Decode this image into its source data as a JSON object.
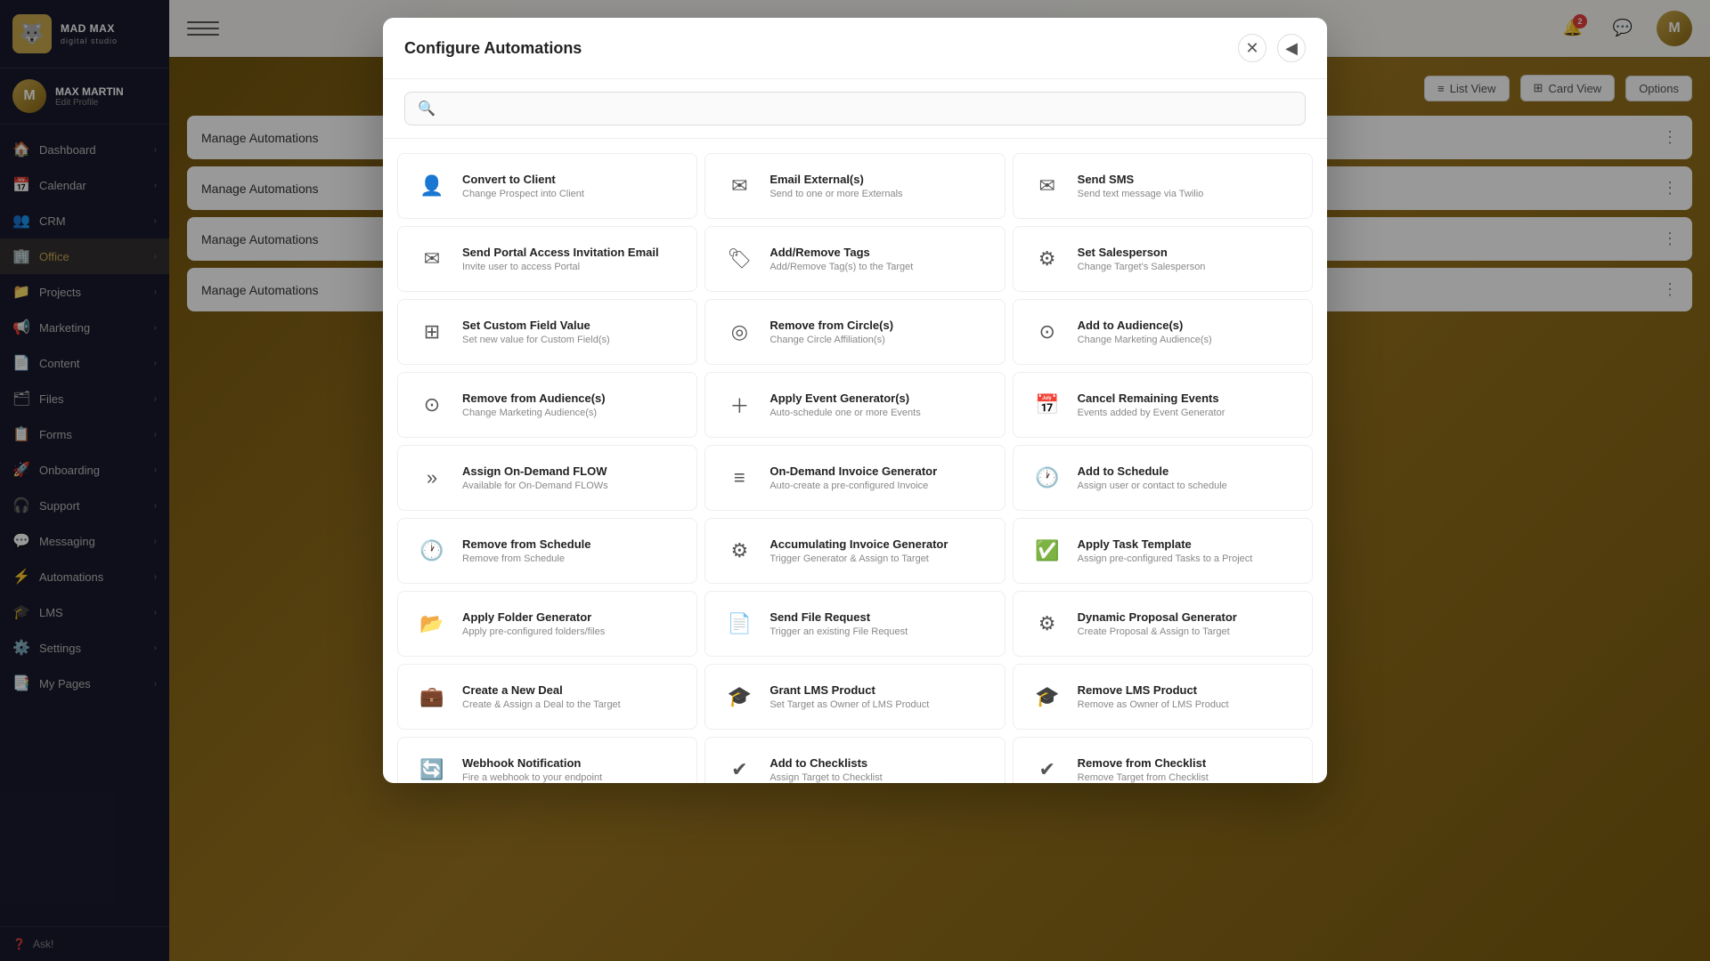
{
  "app": {
    "name": "MAD MAX",
    "sub": "digital studio",
    "logo_emoji": "🐺"
  },
  "user": {
    "name": "MAX MARTIN",
    "edit_label": "Edit Profile",
    "avatar_initials": "M"
  },
  "sidebar": {
    "items": [
      {
        "id": "dashboard",
        "label": "Dashboard",
        "icon": "🏠",
        "has_chevron": true
      },
      {
        "id": "calendar",
        "label": "Calendar",
        "icon": "📅",
        "has_chevron": true
      },
      {
        "id": "crm",
        "label": "CRM",
        "icon": "👥",
        "has_chevron": true
      },
      {
        "id": "office",
        "label": "Office",
        "icon": "🏢",
        "has_chevron": true,
        "active": true
      },
      {
        "id": "projects",
        "label": "Projects",
        "icon": "📁",
        "has_chevron": true
      },
      {
        "id": "marketing",
        "label": "Marketing",
        "icon": "📢",
        "has_chevron": true
      },
      {
        "id": "content",
        "label": "Content",
        "icon": "📄",
        "has_chevron": true
      },
      {
        "id": "files",
        "label": "Files",
        "icon": "🗂",
        "has_chevron": true
      },
      {
        "id": "forms",
        "label": "Forms",
        "icon": "📋",
        "has_chevron": true
      },
      {
        "id": "onboarding",
        "label": "Onboarding",
        "icon": "🚀",
        "has_chevron": true
      },
      {
        "id": "support",
        "label": "Support",
        "icon": "🎧",
        "has_chevron": true
      },
      {
        "id": "messaging",
        "label": "Messaging",
        "icon": "💬",
        "has_chevron": true
      },
      {
        "id": "automations",
        "label": "Automations",
        "icon": "⚡",
        "has_chevron": true
      },
      {
        "id": "lms",
        "label": "LMS",
        "icon": "🎓",
        "has_chevron": true
      },
      {
        "id": "settings",
        "label": "Settings",
        "icon": "⚙️",
        "has_chevron": true
      },
      {
        "id": "mypages",
        "label": "My Pages",
        "icon": "📑",
        "has_chevron": true
      }
    ],
    "bottom": {
      "label": "Ask!",
      "icon": "❓"
    }
  },
  "topbar": {
    "notification_count": "2",
    "view_list_label": "List View",
    "view_card_label": "Card View",
    "options_label": "Options"
  },
  "content": {
    "rows": [
      {
        "label": "Manage Automations"
      },
      {
        "label": "Manage Automations"
      },
      {
        "label": "Manage Automations"
      },
      {
        "label": "Manage Automations"
      }
    ]
  },
  "modal": {
    "title": "Configure Automations",
    "search_placeholder": "",
    "back_icon": "◀",
    "close_icon": "✕",
    "grid_items": [
      {
        "id": "convert-to-client",
        "title": "Convert to Client",
        "desc": "Change Prospect into Client",
        "icon": "👤"
      },
      {
        "id": "email-externals",
        "title": "Email External(s)",
        "desc": "Send to one or more Externals",
        "icon": "@"
      },
      {
        "id": "send-sms",
        "title": "Send SMS",
        "desc": "Send text message via Twilio",
        "icon": "@"
      },
      {
        "id": "send-portal-access",
        "title": "Send Portal Access Invitation Email",
        "desc": "Invite user to access Portal",
        "icon": "✉"
      },
      {
        "id": "add-remove-tags",
        "title": "Add/Remove Tags",
        "desc": "Add/Remove Tag(s) to the Target",
        "icon": "🏷"
      },
      {
        "id": "set-salesperson",
        "title": "Set Salesperson",
        "desc": "Change Target's Salesperson",
        "icon": "⚙"
      },
      {
        "id": "set-custom-field",
        "title": "Set Custom Field Value",
        "desc": "Set new value for Custom Field(s)",
        "icon": "⊞"
      },
      {
        "id": "remove-from-circle",
        "title": "Remove from Circle(s)",
        "desc": "Change Circle Affiliation(s)",
        "icon": "◎"
      },
      {
        "id": "add-to-audiences",
        "title": "Add to Audience(s)",
        "desc": "Change Marketing Audience(s)",
        "icon": "🎯"
      },
      {
        "id": "remove-from-audiences",
        "title": "Remove from Audience(s)",
        "desc": "Change Marketing Audience(s)",
        "icon": "🎯"
      },
      {
        "id": "apply-event-generator",
        "title": "Apply Event Generator(s)",
        "desc": "Auto-schedule one or more Events",
        "icon": "📅"
      },
      {
        "id": "cancel-remaining-events",
        "title": "Cancel Remaining Events",
        "desc": "Events added by Event Generator",
        "icon": "📅"
      },
      {
        "id": "assign-on-demand-flow",
        "title": "Assign On-Demand FLOW",
        "desc": "Available for On-Demand FLOWs",
        "icon": "»"
      },
      {
        "id": "on-demand-invoice-generator",
        "title": "On-Demand Invoice Generator",
        "desc": "Auto-create a pre-configured Invoice",
        "icon": "🧾"
      },
      {
        "id": "add-to-schedule",
        "title": "Add to Schedule",
        "desc": "Assign user or contact to schedule",
        "icon": "🕐"
      },
      {
        "id": "remove-from-schedule",
        "title": "Remove from Schedule",
        "desc": "Remove from Schedule",
        "icon": "🕐"
      },
      {
        "id": "accumulating-invoice-generator",
        "title": "Accumulating Invoice Generator",
        "desc": "Trigger Generator & Assign to Target",
        "icon": "⚙"
      },
      {
        "id": "apply-task-template",
        "title": "Apply Task Template",
        "desc": "Assign pre-configured Tasks to a Project",
        "icon": "✅"
      },
      {
        "id": "apply-folder-generator",
        "title": "Apply Folder Generator",
        "desc": "Apply pre-configured folders/files",
        "icon": "📂"
      },
      {
        "id": "send-file-request",
        "title": "Send File Request",
        "desc": "Trigger an existing File Request",
        "icon": "📄"
      },
      {
        "id": "dynamic-proposal-generator",
        "title": "Dynamic Proposal Generator",
        "desc": "Create Proposal & Assign to Target",
        "icon": "⚙"
      },
      {
        "id": "create-new-deal",
        "title": "Create a New Deal",
        "desc": "Create & Assign a Deal to the Target",
        "icon": "💼"
      },
      {
        "id": "grant-lms-product",
        "title": "Grant LMS Product",
        "desc": "Set Target as Owner of LMS Product",
        "icon": "🎓"
      },
      {
        "id": "remove-lms-product",
        "title": "Remove LMS Product",
        "desc": "Remove as Owner of LMS Product",
        "icon": "🎓"
      },
      {
        "id": "webhook-notification",
        "title": "Webhook Notification",
        "desc": "Fire a webhook to your endpoint",
        "icon": "🔄"
      },
      {
        "id": "add-to-checklists",
        "title": "Add to Checklists",
        "desc": "Assign Target to Checklist",
        "icon": "✔"
      },
      {
        "id": "remove-from-checklist",
        "title": "Remove from Checklist",
        "desc": "Remove Target from Checklist",
        "icon": "✔"
      }
    ]
  }
}
